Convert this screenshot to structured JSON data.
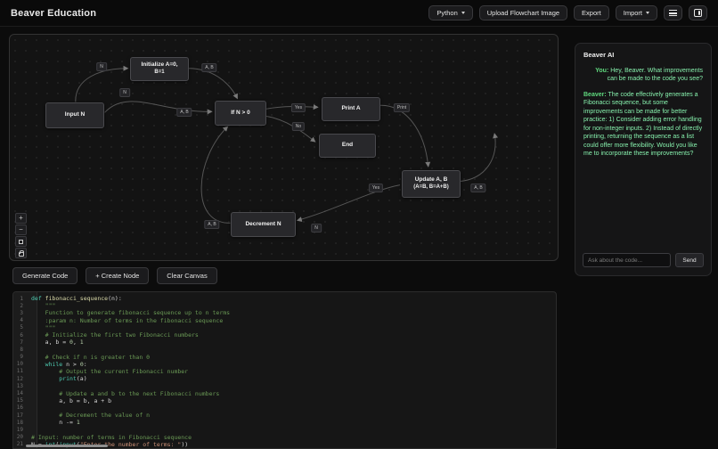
{
  "colors": {
    "accent_green": "#86efac",
    "background": "#0c0c0c",
    "panel": "#151516",
    "node_bg": "#28282b",
    "button_bg": "#1b1b1d",
    "comment_green": "#6a9955"
  },
  "header": {
    "title": "Beaver Education",
    "language_select": "Python",
    "upload_button": "Upload Flowchart Image",
    "export_button": "Export",
    "import_button": "Import"
  },
  "flowchart": {
    "nodes": [
      {
        "label": "Input N"
      },
      {
        "label": "Initialize A=0,",
        "label2": "B=1"
      },
      {
        "label": "If N > 0"
      },
      {
        "label": "Print A"
      },
      {
        "label": "End"
      },
      {
        "label": "Update A, B",
        "label2": "(A=B, B=A+B)"
      },
      {
        "label": "Decrement N"
      }
    ],
    "edge_labels": [
      "N",
      "A, B",
      "N",
      "A, B",
      "Yes",
      "No",
      "Print",
      "Yes",
      "A, B",
      "A, B",
      "N"
    ],
    "controls": {
      "zoom_in": "+",
      "zoom_out": "−"
    }
  },
  "toolbar": {
    "generate_code": "Generate Code",
    "create_node": "+ Create Node",
    "clear_canvas": "Clear Canvas"
  },
  "chat": {
    "title": "Beaver AI",
    "messages": [
      {
        "role": "user",
        "speaker": "You:",
        "text": "Hey, Beaver. What improvements can be made to the code you see?"
      },
      {
        "role": "assistant",
        "speaker": "Beaver:",
        "text": "The code effectively generates a Fibonacci sequence, but some improvements can be made for better practice: 1) Consider adding error handling for non-integer inputs. 2) Instead of directly printing, returning the sequence as a list could offer more flexibility. Would you like me to incorporate these improvements?"
      }
    ],
    "input_placeholder": "Ask about the code...",
    "send_button": "Send"
  },
  "code_editor": {
    "lines": [
      {
        "n": 1,
        "s": [
          [
            "kw",
            "def "
          ],
          [
            "fn",
            "fibonacci_sequence"
          ],
          [
            "pl",
            "(n):"
          ]
        ]
      },
      {
        "n": 2,
        "s": [
          [
            "cm",
            "    \"\"\""
          ]
        ]
      },
      {
        "n": 3,
        "s": [
          [
            "cm",
            "    Function to generate fibonacci sequence up to n terms"
          ]
        ]
      },
      {
        "n": 4,
        "s": [
          [
            "cm",
            "    :param n: Number of terms in the fibonacci sequence"
          ]
        ]
      },
      {
        "n": 5,
        "s": [
          [
            "cm",
            "    \"\"\""
          ]
        ]
      },
      {
        "n": 6,
        "s": [
          [
            "cm",
            "    # Initialize the first two Fibonacci numbers"
          ]
        ]
      },
      {
        "n": 7,
        "s": [
          [
            "pl",
            "    a, b = "
          ],
          [
            "nu",
            "0"
          ],
          [
            "pl",
            ", "
          ],
          [
            "nu",
            "1"
          ]
        ]
      },
      {
        "n": 8,
        "s": []
      },
      {
        "n": 9,
        "s": [
          [
            "cm",
            "    # Check if n is greater than 0"
          ]
        ]
      },
      {
        "n": 10,
        "s": [
          [
            "kw",
            "    while"
          ],
          [
            "pl",
            " n > "
          ],
          [
            "nu",
            "0"
          ],
          [
            "pl",
            ":"
          ]
        ]
      },
      {
        "n": 11,
        "s": [
          [
            "cm",
            "        # Output the current Fibonacci number"
          ]
        ]
      },
      {
        "n": 12,
        "s": [
          [
            "bi",
            "        print"
          ],
          [
            "pl",
            "(a)"
          ]
        ]
      },
      {
        "n": 13,
        "s": []
      },
      {
        "n": 14,
        "s": [
          [
            "cm",
            "        # Update a and b to the next Fibonacci numbers"
          ]
        ]
      },
      {
        "n": 15,
        "s": [
          [
            "pl",
            "        a, b = b, a + b"
          ]
        ]
      },
      {
        "n": 16,
        "s": []
      },
      {
        "n": 17,
        "s": [
          [
            "cm",
            "        # Decrement the value of n"
          ]
        ]
      },
      {
        "n": 18,
        "s": [
          [
            "pl",
            "        n -= "
          ],
          [
            "nu",
            "1"
          ]
        ]
      },
      {
        "n": 19,
        "s": []
      },
      {
        "n": 20,
        "s": [
          [
            "cm",
            "# Input: number of terms in Fibonacci sequence"
          ]
        ]
      },
      {
        "n": 21,
        "s": [
          [
            "pl",
            "N = "
          ],
          [
            "bi",
            "int"
          ],
          [
            "pl",
            "("
          ],
          [
            "bi",
            "input"
          ],
          [
            "pl",
            "("
          ],
          [
            "st",
            "\"Enter the number of terms: \""
          ],
          [
            "pl",
            "))"
          ]
        ]
      }
    ]
  }
}
